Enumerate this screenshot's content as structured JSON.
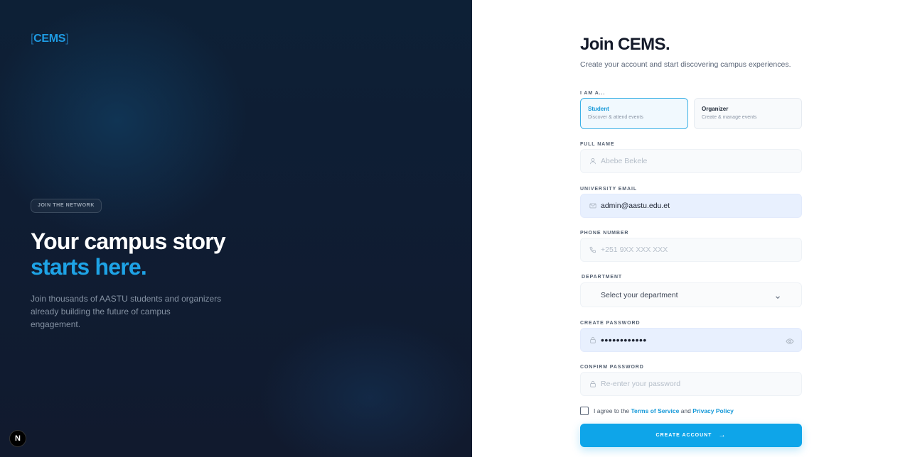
{
  "brand": {
    "open": "[",
    "name": "CEMS",
    "close": "]"
  },
  "hero": {
    "pill": "JOIN THE NETWORK",
    "line1": "Your campus story",
    "line2": "starts here.",
    "lead": "Join thousands of AASTU students and organizers already building the future of campus engagement."
  },
  "nextjs_badge": "N",
  "form": {
    "title": "Join CEMS.",
    "subtitle": "Create your account and start discovering campus experiences.",
    "role_label": "I AM A...",
    "roles": [
      {
        "title": "Student",
        "desc": "Discover & attend events",
        "selected": true
      },
      {
        "title": "Organizer",
        "desc": "Create & manage events",
        "selected": false
      }
    ],
    "full_name": {
      "label": "FULL NAME",
      "placeholder": "Abebe Bekele",
      "value": ""
    },
    "email": {
      "label": "UNIVERSITY EMAIL",
      "value": "admin@aastu.edu.et"
    },
    "phone": {
      "label": "PHONE NUMBER",
      "placeholder": "+251 9XX XXX XXX",
      "value": ""
    },
    "department": {
      "label": "DEPARTMENT",
      "value": "Select your department"
    },
    "password": {
      "label": "CREATE PASSWORD",
      "value": "••••••••••••"
    },
    "confirm": {
      "label": "CONFIRM PASSWORD",
      "placeholder": "Re-enter your password"
    },
    "agree": {
      "prefix": "I agree to the ",
      "terms": "Terms of Service",
      "and": " and ",
      "privacy": "Privacy Policy"
    },
    "submit": "CREATE ACCOUNT"
  },
  "colors": {
    "accent": "#0ea5e9",
    "panel_dark": "#0f1d33"
  }
}
